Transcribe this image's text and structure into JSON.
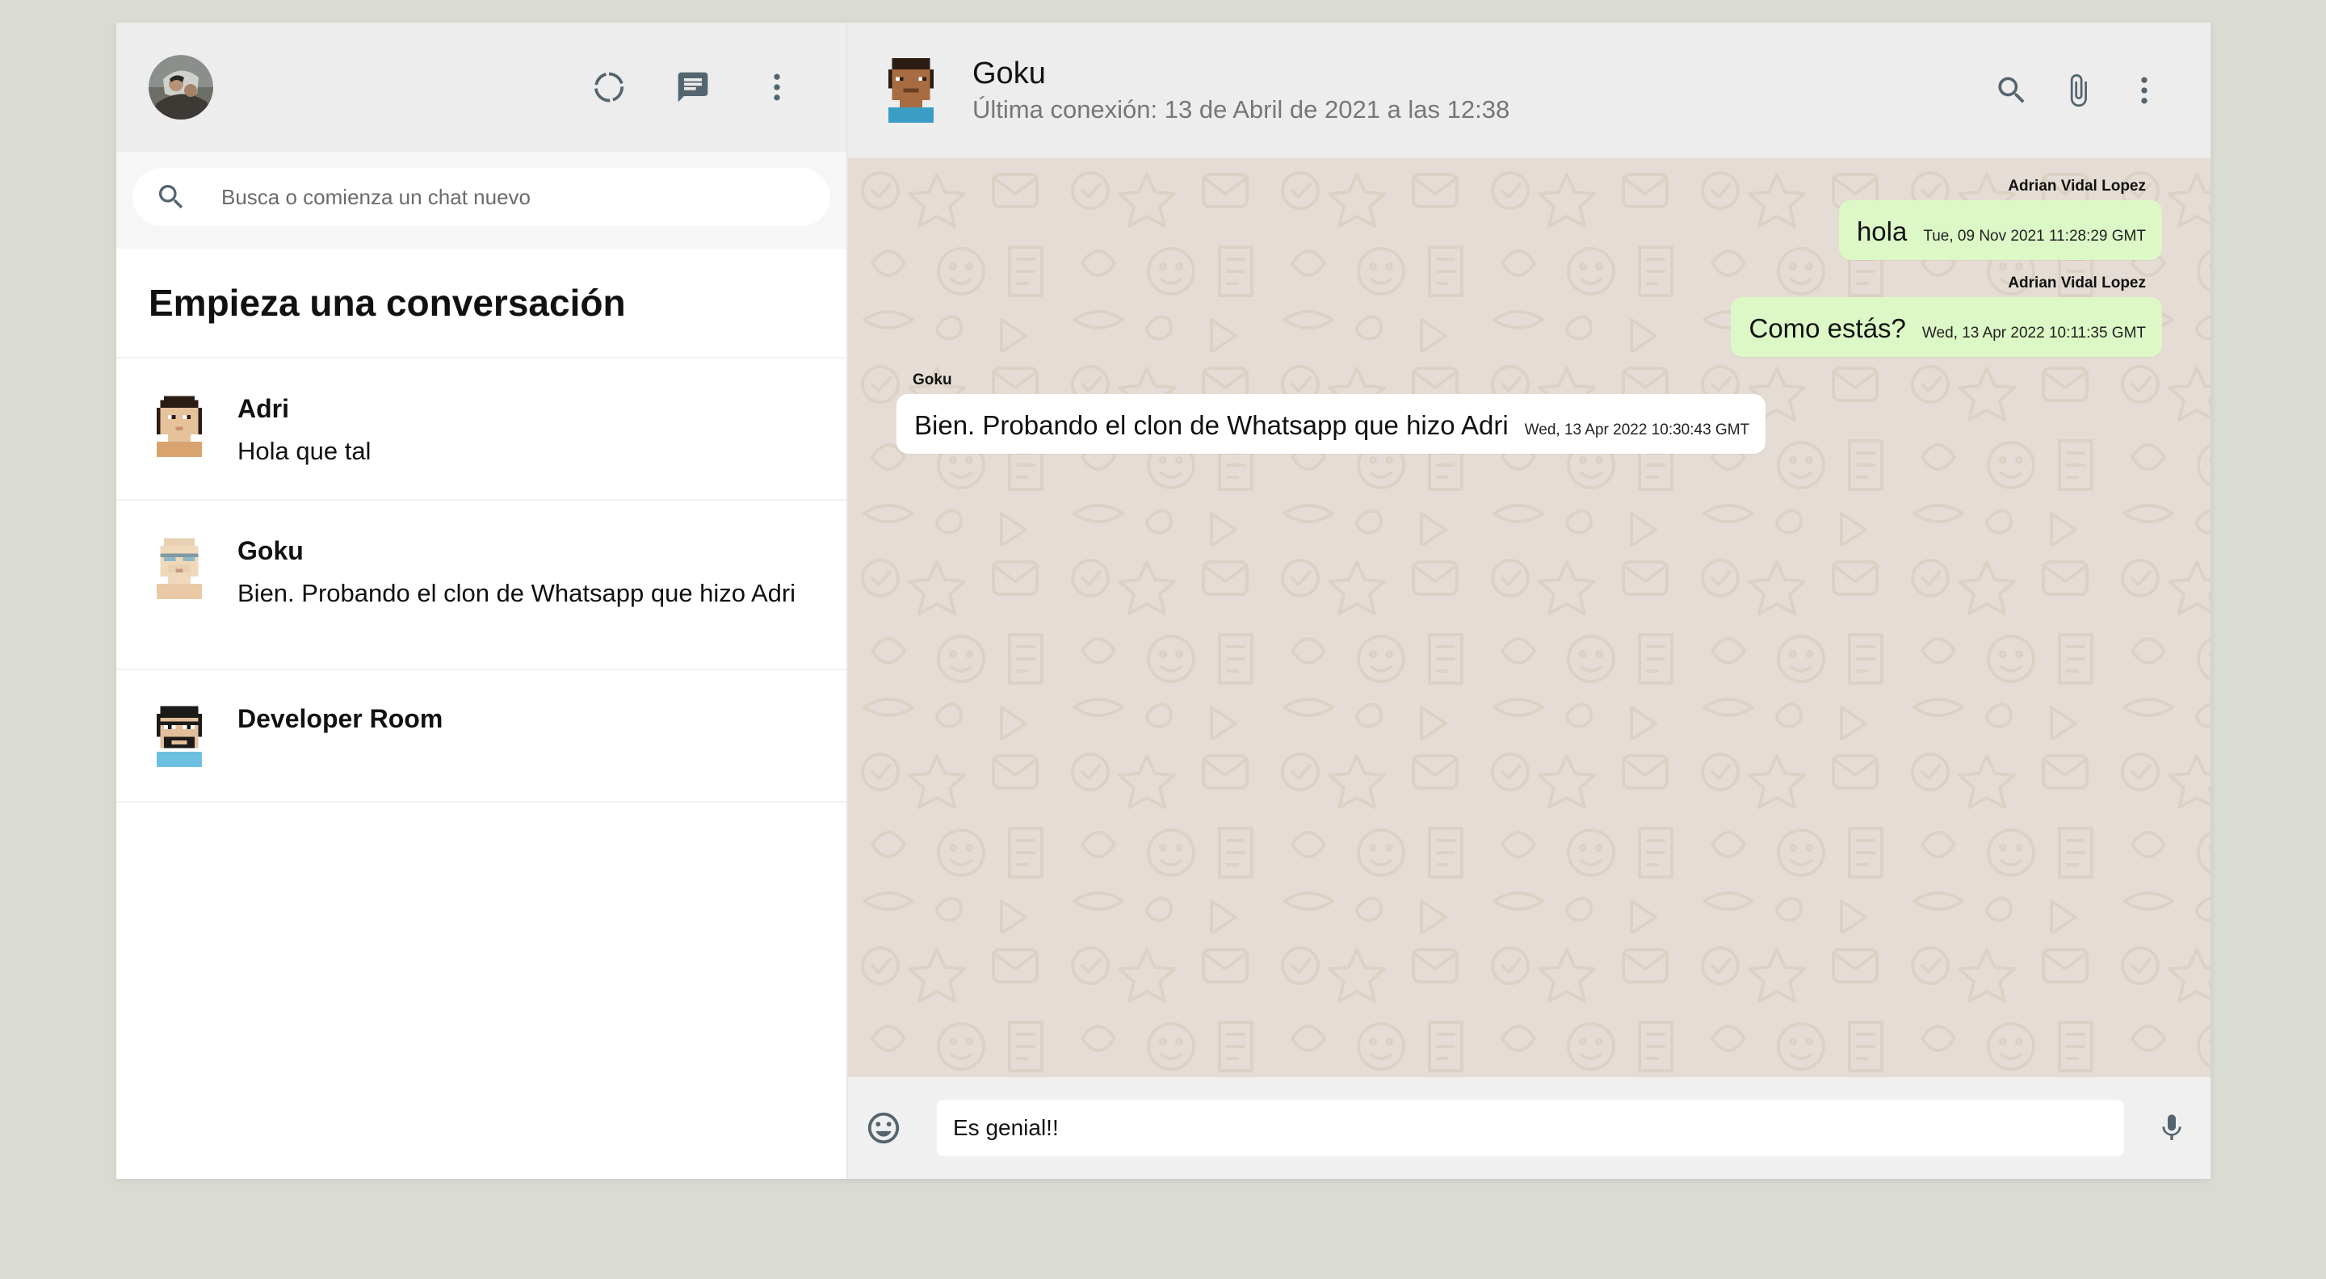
{
  "sidebar": {
    "search_placeholder": "Busca o comienza un chat nuevo",
    "title": "Empieza una conversación",
    "chats": [
      {
        "name": "Adri",
        "last": "Hola que tal"
      },
      {
        "name": "Goku",
        "last": "Bien. Probando el clon de Whatsapp que hizo Adri"
      },
      {
        "name": "Developer Room",
        "last": ""
      }
    ]
  },
  "chat": {
    "name": "Goku",
    "status": "Última conexión: 13 de Abril de 2021 a las 12:38",
    "messages": [
      {
        "sender": "Adrian Vidal Lopez",
        "text": "hola",
        "time": "Tue, 09 Nov 2021 11:28:29 GMT",
        "direction": "out"
      },
      {
        "sender": "Adrian Vidal Lopez",
        "text": "Como estás?",
        "time": "Wed, 13 Apr 2022 10:11:35 GMT",
        "direction": "out"
      },
      {
        "sender": "Goku",
        "text": "Bien. Probando el clon de Whatsapp que hizo Adri",
        "time": "Wed, 13 Apr 2022 10:30:43 GMT",
        "direction": "in"
      }
    ],
    "input_value": "Es genial!!"
  },
  "colors": {
    "background": "#dadbd3",
    "header": "#ededed",
    "outgoing_bubble": "#dcf8c6",
    "chat_bg": "#e5ddd5"
  },
  "icons": [
    "status-icon",
    "new-chat-icon",
    "menu-icon",
    "search-icon",
    "attach-icon",
    "emoji-icon",
    "mic-icon"
  ]
}
